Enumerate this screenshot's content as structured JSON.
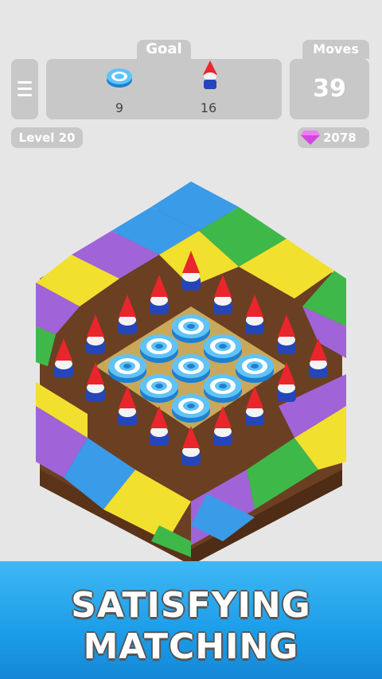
{
  "hud": {
    "goal_label": "Goal",
    "moves_label": "Moves",
    "moves_value": "39",
    "goals": [
      {
        "icon": "blue-rings-icon",
        "count": "9"
      },
      {
        "icon": "gnome-icon",
        "count": "16"
      }
    ],
    "level_label": "Level 20",
    "gems": "2078"
  },
  "banner": {
    "line1": "SATISFYING",
    "line2": "MATCHING"
  },
  "colors": {
    "blue_grass": "#3a9be8",
    "yellow_grass": "#f2e02e",
    "purple_grass": "#a064d8",
    "green_grass": "#3fb84a",
    "soil": "#6b3f22"
  }
}
